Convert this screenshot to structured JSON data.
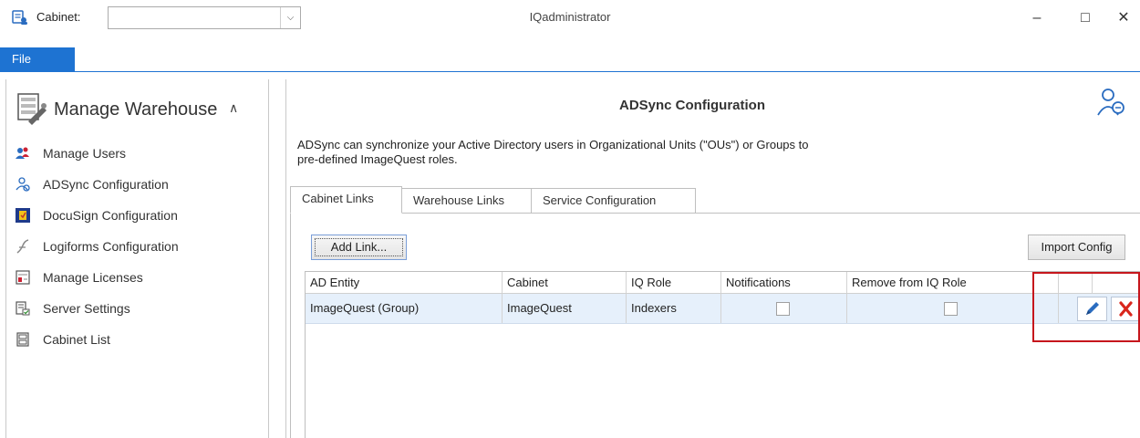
{
  "titlebar": {
    "cabinet_label": "Cabinet:",
    "cabinet_value": "",
    "window_title": "IQadministrator"
  },
  "ribbon": {
    "file_label": "File"
  },
  "sidebar": {
    "title": "Manage Warehouse",
    "items": [
      {
        "label": "Manage Users",
        "icon": "users-icon"
      },
      {
        "label": "ADSync Configuration",
        "icon": "adsync-icon"
      },
      {
        "label": "DocuSign Configuration",
        "icon": "docusign-icon"
      },
      {
        "label": "Logiforms Configuration",
        "icon": "logiforms-icon"
      },
      {
        "label": "Manage Licenses",
        "icon": "license-icon"
      },
      {
        "label": "Server Settings",
        "icon": "server-settings-icon"
      },
      {
        "label": "Cabinet List",
        "icon": "cabinet-list-icon"
      }
    ]
  },
  "main": {
    "title": "ADSync Configuration",
    "description_line1": "ADSync can synchronize your Active Directory users in Organizational Units (\"OUs\") or Groups to",
    "description_line2": "pre-defined ImageQuest roles.",
    "tabs": [
      {
        "label": "Cabinet Links",
        "active": true
      },
      {
        "label": "Warehouse Links",
        "active": false
      },
      {
        "label": "Service Configuration",
        "active": false
      }
    ],
    "add_link_label": "Add Link...",
    "import_config_label": "Import Config",
    "grid": {
      "columns": [
        "AD Entity",
        "Cabinet",
        "IQ Role",
        "Notifications",
        "Remove from IQ Role"
      ],
      "rows": [
        {
          "ad_entity": "ImageQuest (Group)",
          "cabinet": "ImageQuest",
          "iq_role": "Indexers",
          "notifications": false,
          "remove_from_iq_role": false
        }
      ]
    }
  },
  "colors": {
    "accent": "#1e73d2",
    "row_selected": "#e6f0fb",
    "highlight_border": "#c6161c",
    "delete_red": "#d9261c",
    "edit_blue": "#2a6cc0"
  }
}
